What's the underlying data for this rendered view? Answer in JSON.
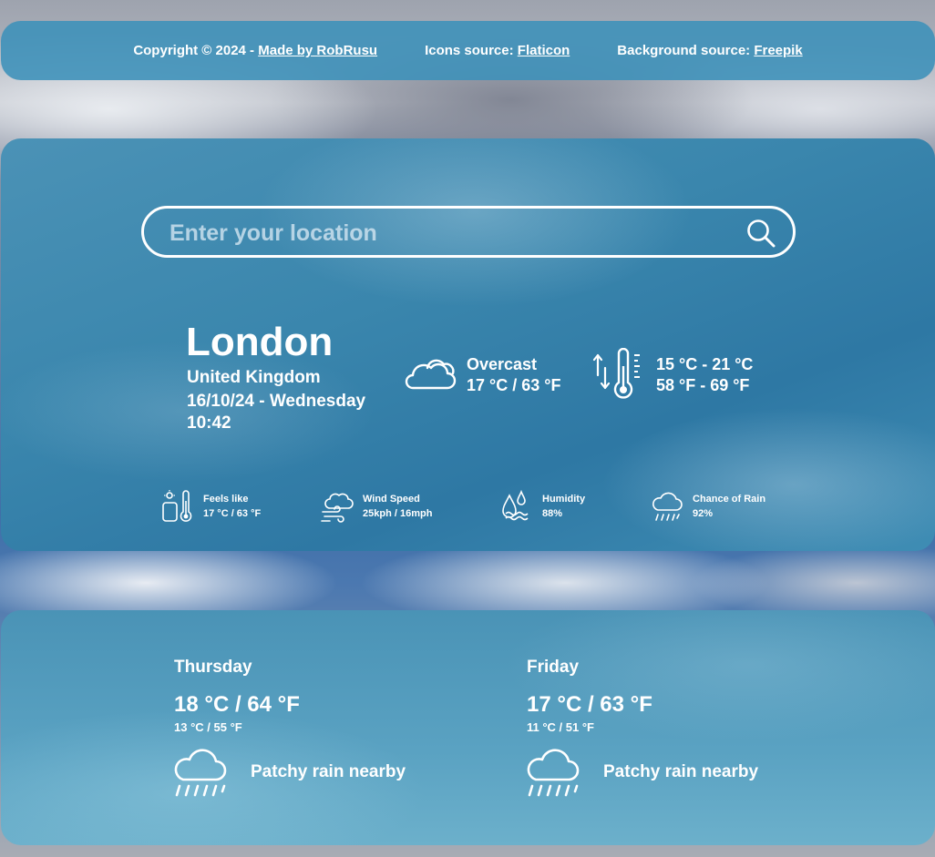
{
  "footer": {
    "copyright_prefix": "Copyright © 2024 - ",
    "made_by_link": "Made by RobRusu",
    "icons_prefix": "Icons source: ",
    "icons_link": "Flaticon",
    "background_prefix": "Background source: ",
    "background_link": "Freepik"
  },
  "search": {
    "placeholder": "Enter your location",
    "icon": "search-icon"
  },
  "location": {
    "city": "London",
    "country": "United Kingdom",
    "date": "16/10/24 - Wednesday",
    "time": "10:42"
  },
  "current": {
    "condition": "Overcast",
    "temp": "17 °C / 63 °F",
    "condition_icon": "cloud-icon",
    "range_c": "15 °C - 21 °C",
    "range_f": "58 °F - 69 °F",
    "range_icon": "thermometer-range-icon"
  },
  "stats": [
    {
      "label": "Feels like",
      "value": "17 °C / 63 °F",
      "icon": "feels-like-icon"
    },
    {
      "label": "Wind Speed",
      "value": "25kph / 16mph",
      "icon": "wind-icon"
    },
    {
      "label": "Humidity",
      "value": "88%",
      "icon": "humidity-icon"
    },
    {
      "label": "Chance of Rain",
      "value": "92%",
      "icon": "rain-cloud-icon"
    }
  ],
  "forecast": [
    {
      "day": "Thursday",
      "max": "18 °C / 64 °F",
      "min": "13 °C / 55 °F",
      "condition": "Patchy rain nearby",
      "icon": "rain-cloud-icon"
    },
    {
      "day": "Friday",
      "max": "17 °C / 63 °F",
      "min": "11 °C / 51 °F",
      "condition": "Patchy rain nearby",
      "icon": "rain-cloud-icon"
    }
  ],
  "colors": {
    "panel": "#3c91b9",
    "text": "#ffffff"
  }
}
